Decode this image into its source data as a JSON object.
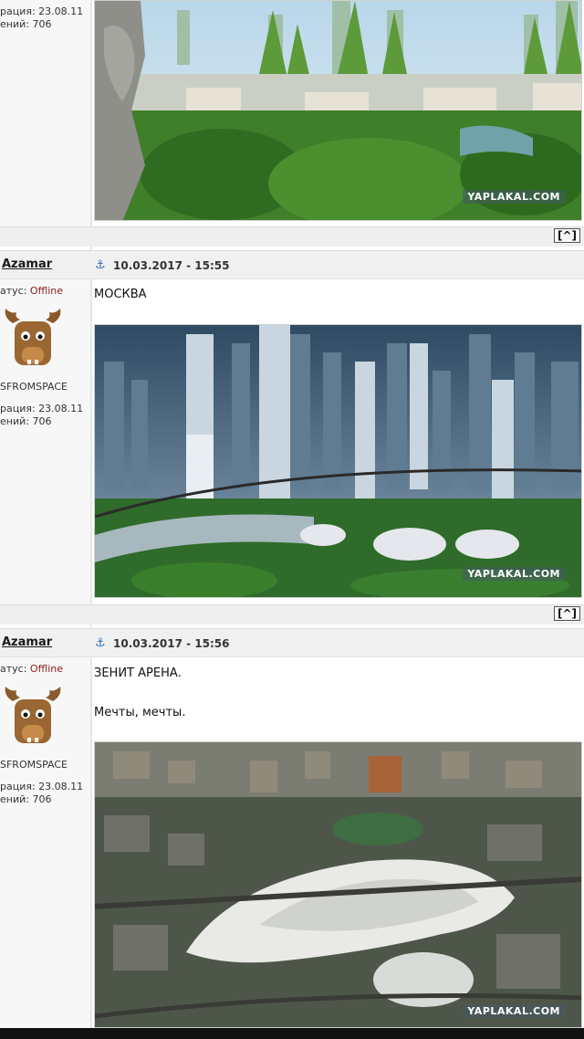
{
  "top_partial_profile": {
    "reg_label": "рация: 23.08.11",
    "posts_label": "ений: 706"
  },
  "posts": [
    {
      "author": "Azamar",
      "status_label": "атус:",
      "status_value": "Offline",
      "group": "SFROMSPACE",
      "reg_label": "рация: 23.08.11",
      "posts_label": "ений: 706",
      "datetime": "10.03.2017 - 15:55",
      "text_lines": [
        "МОСКВА"
      ],
      "watermark": "YAPLAKAL.COM"
    },
    {
      "author": "Azamar",
      "status_label": "атус:",
      "status_value": "Offline",
      "group": "SFROMSPACE",
      "reg_label": "рация: 23.08.11",
      "posts_label": "ений: 706",
      "datetime": "10.03.2017 - 15:56",
      "text_lines": [
        "ЗЕНИТ АРЕНА.",
        "Мечты, мечты."
      ],
      "watermark": "YAPLAKAL.COM"
    }
  ],
  "top_image_watermark": "YAPLAKAL.COM",
  "to_top_label": "[^]",
  "colors": {
    "offline": "#8b1a1a",
    "anchor": "#2a6fb0"
  }
}
